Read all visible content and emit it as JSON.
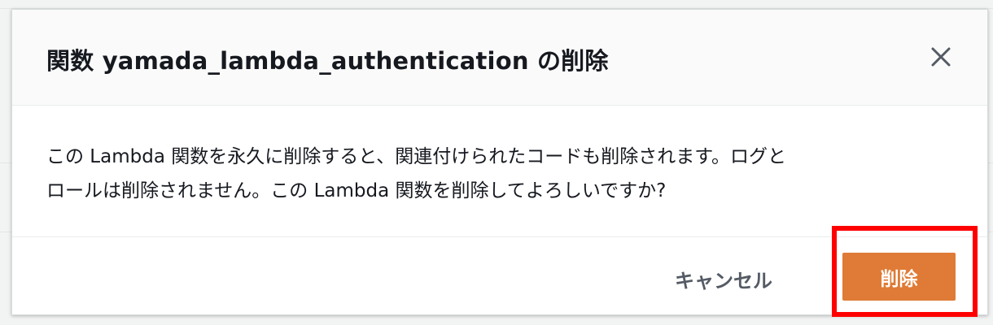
{
  "dialog": {
    "title": "関数 yamada_lambda_authentication の削除",
    "close_icon": "close-icon",
    "body_line1": "この Lambda 関数を永久に削除すると、関連付けられたコードも削除されます。ログと",
    "body_line2": "ロールは削除されません。この Lambda 関数を削除してよろしいですか?",
    "cancel_label": "キャンセル",
    "delete_label": "削除"
  },
  "colors": {
    "delete_button": "#df7b36",
    "highlight": "#ff0000"
  }
}
